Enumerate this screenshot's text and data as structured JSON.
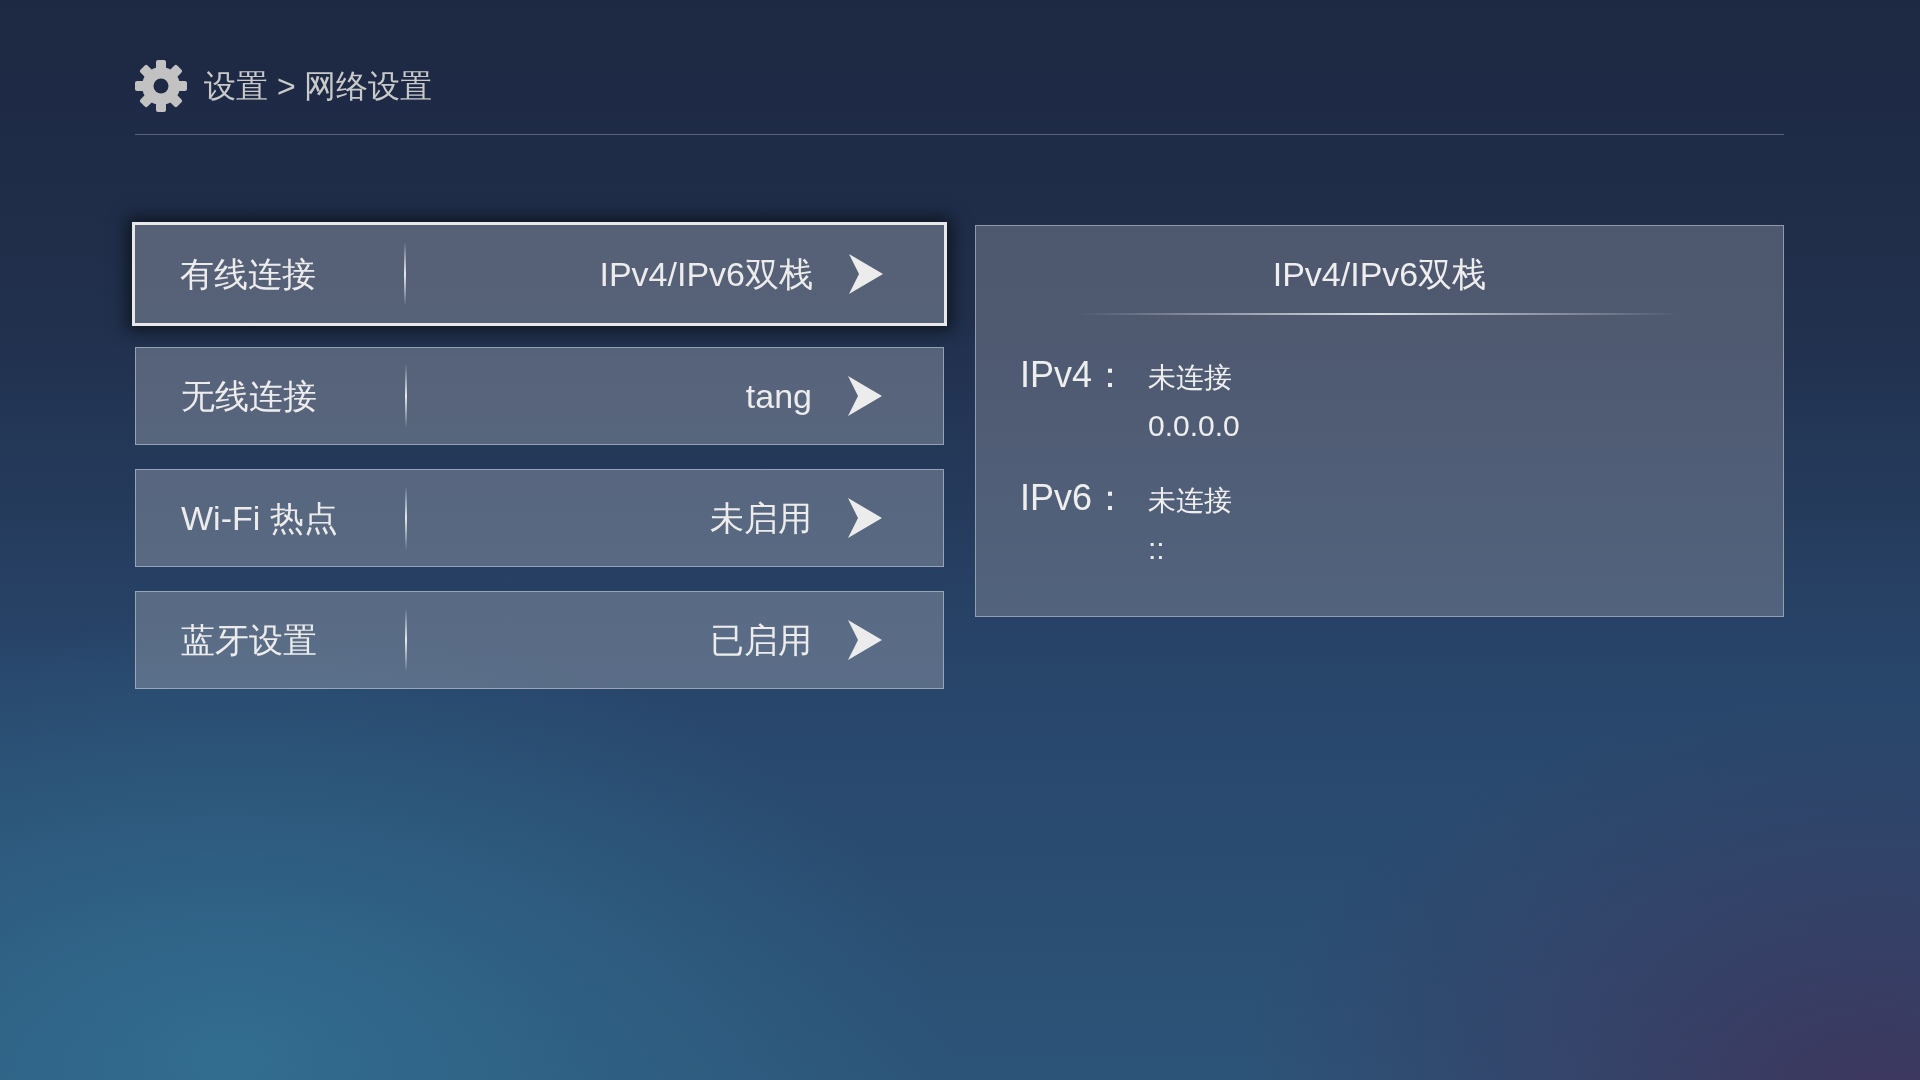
{
  "header": {
    "breadcrumb": "设置 > 网络设置"
  },
  "menu": [
    {
      "label": "有线连接",
      "value": "IPv4/IPv6双栈",
      "selected": true
    },
    {
      "label": "无线连接",
      "value": "tang",
      "selected": false
    },
    {
      "label": "Wi-Fi 热点",
      "value": "未启用",
      "selected": false
    },
    {
      "label": "蓝牙设置",
      "value": "已启用",
      "selected": false
    }
  ],
  "detail_panel": {
    "title": "IPv4/IPv6双栈",
    "entries": [
      {
        "label": "IPv4：",
        "status": "未连接",
        "address": "0.0.0.0"
      },
      {
        "label": "IPv6：",
        "status": "未连接",
        "address": "::"
      }
    ]
  }
}
